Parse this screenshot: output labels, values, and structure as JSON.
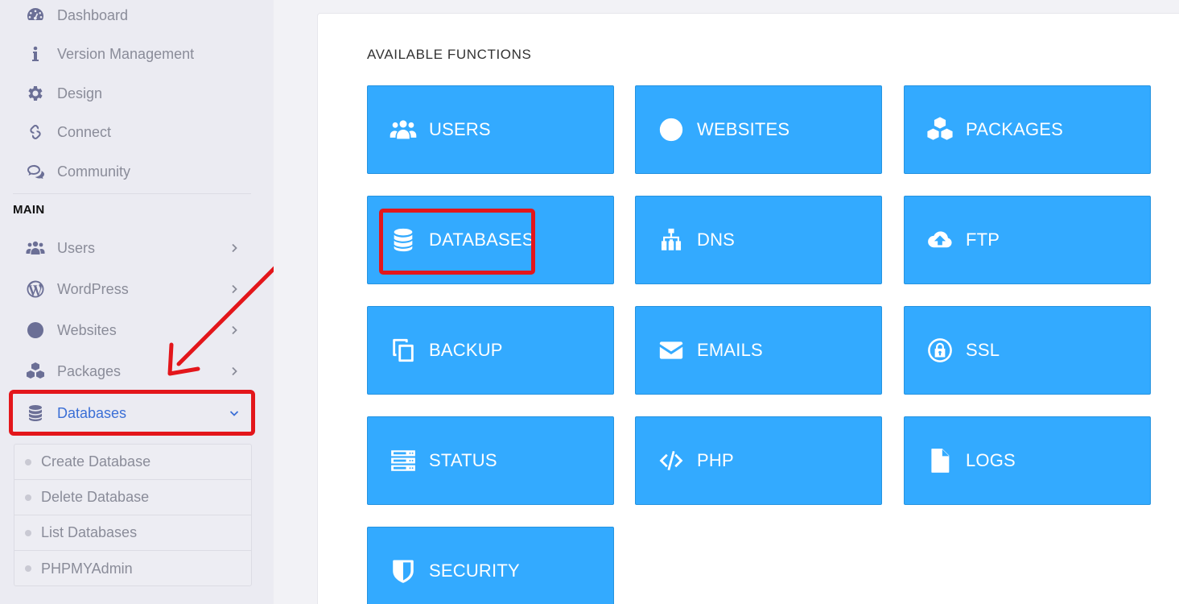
{
  "sidebar": {
    "top_items": [
      {
        "label": "Dashboard",
        "icon": "dashboard-icon"
      },
      {
        "label": "Version Management",
        "icon": "info-icon"
      },
      {
        "label": "Design",
        "icon": "gear-icon"
      },
      {
        "label": "Connect",
        "icon": "link-icon"
      },
      {
        "label": "Community",
        "icon": "chat-icon"
      }
    ],
    "section_title": "MAIN",
    "main_items": [
      {
        "label": "Users",
        "icon": "users-icon"
      },
      {
        "label": "WordPress",
        "icon": "wordpress-icon"
      },
      {
        "label": "Websites",
        "icon": "globe-icon"
      },
      {
        "label": "Packages",
        "icon": "cubes-icon"
      },
      {
        "label": "Databases",
        "icon": "database-icon",
        "expanded": true
      }
    ],
    "databases_submenu": [
      {
        "label": "Create Database"
      },
      {
        "label": "Delete Database"
      },
      {
        "label": "List Databases"
      },
      {
        "label": "PHPMYAdmin"
      }
    ]
  },
  "main": {
    "heading": "AVAILABLE FUNCTIONS",
    "tiles": [
      {
        "label": "USERS",
        "icon": "users-icon"
      },
      {
        "label": "WEBSITES",
        "icon": "globe-icon"
      },
      {
        "label": "PACKAGES",
        "icon": "cubes-icon"
      },
      {
        "label": "DATABASES",
        "icon": "database-icon"
      },
      {
        "label": "DNS",
        "icon": "sitemap-icon"
      },
      {
        "label": "FTP",
        "icon": "cloud-upload-icon"
      },
      {
        "label": "BACKUP",
        "icon": "copy-icon"
      },
      {
        "label": "EMAILS",
        "icon": "envelope-icon"
      },
      {
        "label": "SSL",
        "icon": "lock-icon"
      },
      {
        "label": "STATUS",
        "icon": "server-icon"
      },
      {
        "label": "PHP",
        "icon": "code-icon"
      },
      {
        "label": "LOGS",
        "icon": "file-icon"
      },
      {
        "label": "SECURITY",
        "icon": "shield-icon"
      }
    ]
  },
  "colors": {
    "tile_blue": "#33aaff",
    "highlight_red": "#e3161b",
    "active_link": "#3b6fd6",
    "sidebar_icon": "#6b6f96"
  }
}
